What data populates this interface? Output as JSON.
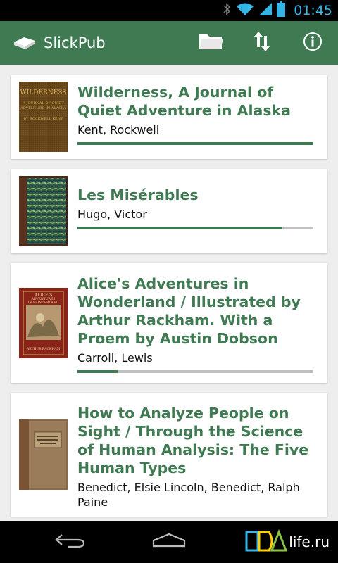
{
  "status_bar": {
    "time": "01:45",
    "icons": [
      "bluetooth-icon",
      "wifi-icon",
      "signal-icon",
      "battery-icon"
    ],
    "time_color": "#33b5e5"
  },
  "action_bar": {
    "title": "SlickPub",
    "background": "#3f7a53",
    "actions": [
      "folder-icon",
      "sort-icon",
      "info-icon"
    ]
  },
  "books": [
    {
      "title": "Wilderness, A Journal of Quiet Adventure in Alaska",
      "author": "Kent, Rockwell",
      "progress": 1.0,
      "cover": {
        "line1": "WILDERNESS",
        "line2": "A JOURNAL OF QUIET",
        "line3": "ADVENTURE IN ALASKA",
        "line4": "BY ROCKWELL KENT"
      }
    },
    {
      "title": "Les Misérables",
      "author": "Hugo, Victor",
      "progress": 0.87
    },
    {
      "title": "Alice's Adventures in Wonderland / Illustrated by Arthur Rackham. With a Proem by Austin Dobson",
      "author": "Carroll, Lewis",
      "progress": 0.17,
      "cover": {
        "line1": "ALICE'S",
        "line2": "ADVENTURES",
        "line3": "IN WONDERLAND",
        "line4": "ARTHUR RACKHAM"
      }
    },
    {
      "title": "How to Analyze People on Sight / Through the Science of Human Analysis: The Five Human Types",
      "author": "Benedict, Elsie Lincoln, Benedict, Ralph Paine",
      "progress": null
    }
  ],
  "nav_bar": {
    "buttons": [
      "back-icon",
      "home-icon",
      "recent-apps-icon"
    ],
    "watermark": "life.ru"
  }
}
